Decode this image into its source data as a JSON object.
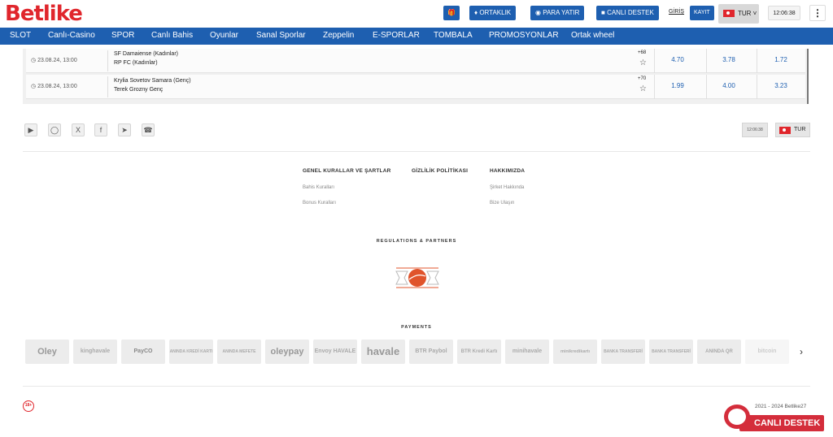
{
  "header": {
    "logo": "Betlike",
    "gift_icon": "gift-icon",
    "ortaklik": "ORTAKLIK",
    "para_yatir": "PARA YATIR",
    "canli_destek": "CANLI DESTEK",
    "giris": "GİRİŞ",
    "kayit": "KAYIT",
    "language": "TUR",
    "time": "12:06:38"
  },
  "nav": [
    "SLOT",
    "Canlı-Casino",
    "SPOR",
    "Canlı Bahis",
    "Oyunlar",
    "Sanal Sporlar",
    "Zeppelin",
    "E-SPORLAR",
    "TOMBALA",
    "PROMOSYONLAR",
    "Ortak wheel"
  ],
  "matches": [
    {
      "date": "23.08.24, 13:00",
      "home": "SF Damaiense (Kadınlar)",
      "away": "RP FC (Kadınlar)",
      "more": "+68",
      "odds": [
        "4.70",
        "3.78",
        "1.72"
      ]
    },
    {
      "date": "23.08.24, 13:00",
      "home": "Krylia Sovetov Samara (Genç)",
      "away": "Terek Grozny Genç",
      "more": "+70",
      "odds": [
        "1.99",
        "4.00",
        "3.23"
      ]
    }
  ],
  "footer": {
    "time": "12:06:38",
    "language": "TUR",
    "cols": [
      {
        "title": "GENEL KURALLAR VE ŞARTLAR",
        "links": [
          "Bahis Kuralları",
          "Bonus Kuralları"
        ]
      },
      {
        "title": "GİZLİLİK POLİTİKASI",
        "links": []
      },
      {
        "title": "HAKKIMIZDA",
        "links": [
          "Şirket Hakkında",
          "Bize Ulaşın"
        ]
      }
    ],
    "regulations": "REGULATIONS & PARTNERS",
    "payments": "PAYMENTS",
    "payment_methods": [
      "Oley",
      "kinghavale",
      "PayCO",
      "ANINDA KREDİ KARTI",
      "ANINDA MEFETE",
      "oleypay",
      "Envoy HAVALE",
      "havale",
      "BTR Paybol",
      "BTR Kredi Kartı",
      "minihavale",
      "minikredikartı",
      "BANKA TRANSFERİ",
      "BANKA TRANSFERİ",
      "ANINDA QR",
      "bitcoin"
    ],
    "age": "18+",
    "copyright": "2021 - 2024 Betlike27",
    "live_support": "CANLI DESTEK"
  }
}
